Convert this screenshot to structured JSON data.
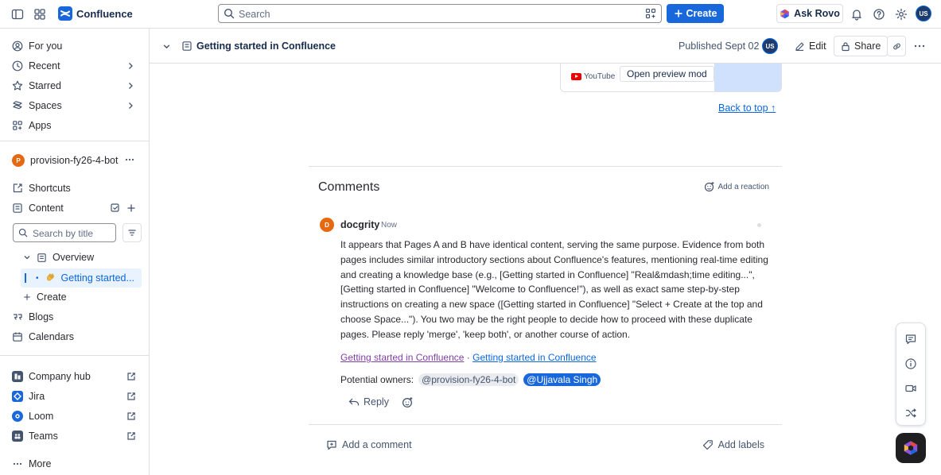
{
  "topbar": {
    "brand": "Confluence",
    "search_placeholder": "Search",
    "create_label": "Create",
    "ask_rovo_label": "Ask Rovo",
    "user_initials": "US"
  },
  "sidebar": {
    "nav": [
      {
        "label": "For you"
      },
      {
        "label": "Recent"
      },
      {
        "label": "Starred"
      },
      {
        "label": "Spaces"
      },
      {
        "label": "Apps"
      }
    ],
    "space": {
      "initial": "P",
      "name": "provision-fy26-4-bot"
    },
    "space_items": {
      "shortcuts": "Shortcuts",
      "content": "Content"
    },
    "search_placeholder": "Search by title",
    "tree": {
      "overview": "Overview",
      "page": "Getting started...",
      "create": "Create"
    },
    "more_items": {
      "blogs": "Blogs",
      "calendars": "Calendars"
    },
    "apps": [
      {
        "label": "Company hub"
      },
      {
        "label": "Jira"
      },
      {
        "label": "Loom"
      },
      {
        "label": "Teams"
      }
    ],
    "more": "More"
  },
  "page": {
    "title": "Getting started in Confluence",
    "published": "Published Sept 02",
    "author_initials": "US",
    "edit_label": "Edit",
    "share_label": "Share"
  },
  "embed": {
    "source": "YouTube",
    "preview_label": "Open preview mod"
  },
  "back_to_top": "Back to top ↑",
  "comments": {
    "title": "Comments",
    "add_reaction": "Add a reaction",
    "author_initial": "D",
    "author": "docgrity",
    "time": "Now",
    "body": "It appears that Pages A and B have identical content, serving the same purpose. Evidence from both pages includes similar introductory sections about Confluence's features, mentioning real-time editing and creating a knowledge base (e.g., [Getting started in Confluence] \"Real&mdash;time editing...\", [Getting started in Confluence] \"Welcome to Confluence!\"), as well as exact same step-by-step instructions on creating a new space ([Getting started in Confluence] \"Select + Create at the top and choose Space...\"). You two may be the right people to decide how to proceed with these duplicate pages. Please reply 'merge', 'keep both', or another course of action.",
    "link1": "Getting started in Confluence",
    "link_sep": " · ",
    "link2": "Getting started in Confluence",
    "owners_label": "Potential owners:",
    "owner1": "@provision-fy26-4-bot",
    "owner2": "@Ujjavala Singh",
    "reply": "Reply",
    "add_comment": "Add a comment",
    "add_labels": "Add labels"
  },
  "colors": {
    "accent": "#1868db",
    "text": "#172b4d",
    "border": "#dcdfe4"
  }
}
